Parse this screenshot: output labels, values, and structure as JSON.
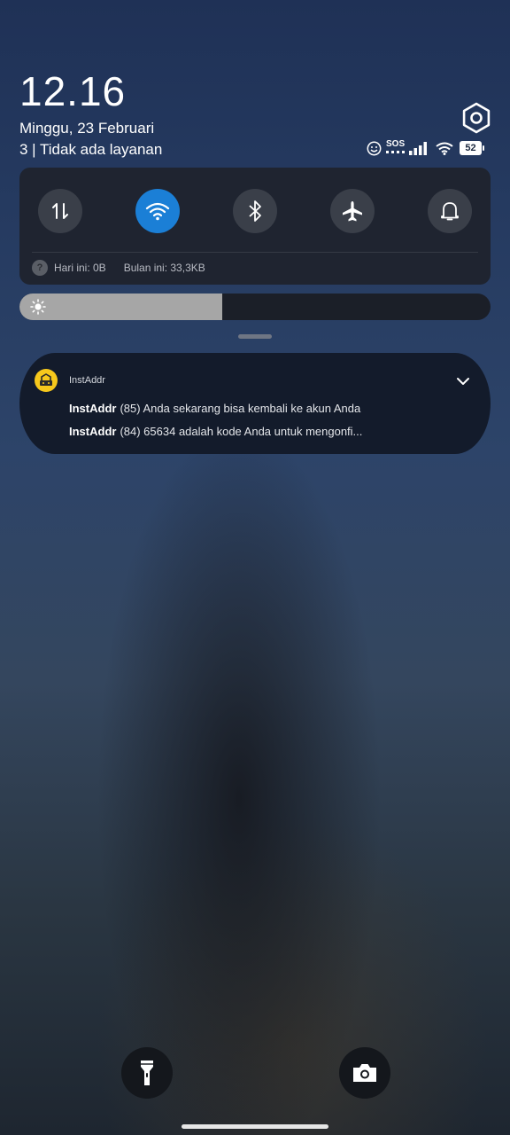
{
  "clock": {
    "time": "12.16",
    "date": "Minggu, 23 Februari",
    "carrier": "3 | Tidak ada layanan"
  },
  "status": {
    "sos_label": "SOS",
    "battery_level": "52"
  },
  "quick_settings": {
    "tiles": [
      {
        "id": "mobile-data",
        "icon": "data-transfer-icon",
        "active": false
      },
      {
        "id": "wifi",
        "icon": "wifi-icon",
        "active": true
      },
      {
        "id": "bluetooth",
        "icon": "bluetooth-icon",
        "active": false
      },
      {
        "id": "airplane",
        "icon": "airplane-icon",
        "active": false
      },
      {
        "id": "sound",
        "icon": "bell-icon",
        "active": false
      }
    ],
    "data_usage": {
      "today": "Hari ini: 0B",
      "month": "Bulan ini: 33,3KB"
    }
  },
  "brightness": {
    "level_fraction": 0.43
  },
  "notification": {
    "app_name": "InstAddr",
    "messages": [
      {
        "sender": "InstAddr",
        "text": "(85) Anda sekarang bisa kembali ke akun Anda"
      },
      {
        "sender": "InstAddr",
        "text": "(84) 65634 adalah kode Anda untuk mengonfi..."
      }
    ]
  },
  "bottom_actions": [
    {
      "id": "flashlight",
      "icon": "flashlight-icon"
    },
    {
      "id": "camera",
      "icon": "camera-icon"
    }
  ],
  "colors": {
    "accent": "#1b7fd6",
    "app_icon": "#f6c81c"
  }
}
